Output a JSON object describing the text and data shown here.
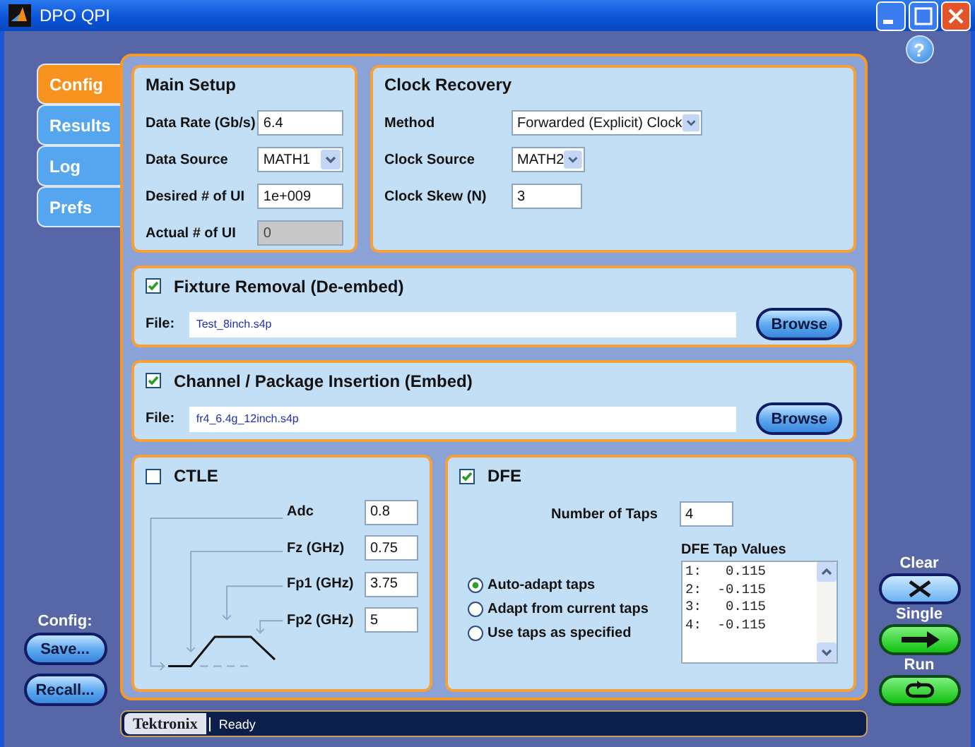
{
  "window": {
    "title": "DPO QPI"
  },
  "tabs": [
    {
      "label": "Config",
      "selected": true
    },
    {
      "label": "Results",
      "selected": false
    },
    {
      "label": "Log",
      "selected": false
    },
    {
      "label": "Prefs",
      "selected": false
    }
  ],
  "help": "?",
  "main_setup": {
    "title": "Main Setup",
    "fields": [
      {
        "label": "Data Rate (Gb/s)",
        "value": "6.4",
        "kind": "text"
      },
      {
        "label": "Data Source",
        "value": "MATH1",
        "kind": "dropdown"
      },
      {
        "label": "Desired # of UI",
        "value": "1e+009",
        "kind": "text"
      },
      {
        "label": "Actual # of UI",
        "value": "0",
        "kind": "readonly"
      }
    ]
  },
  "clock_recovery": {
    "title": "Clock Recovery",
    "fields": [
      {
        "label": "Method",
        "value": "Forwarded (Explicit) Clock",
        "kind": "dropdown"
      },
      {
        "label": "Clock Source",
        "value": "MATH2",
        "kind": "dropdown"
      },
      {
        "label": "Clock Skew (N)",
        "value": "3",
        "kind": "text"
      }
    ]
  },
  "embeds": [
    {
      "title": "Fixture Removal (De-embed)",
      "checked": true,
      "file_label": "File:",
      "file": "Test_8inch.s4p",
      "button": "Browse"
    },
    {
      "title": "Channel / Package Insertion (Embed)",
      "checked": true,
      "file_label": "File:",
      "file": "fr4_6.4g_12inch.s4p",
      "button": "Browse"
    }
  ],
  "ctle": {
    "title": "CTLE",
    "checked": false,
    "fields": [
      {
        "label": "Adc",
        "value": "0.8"
      },
      {
        "label": "Fz (GHz)",
        "value": "0.75"
      },
      {
        "label": "Fp1 (GHz)",
        "value": "3.75"
      },
      {
        "label": "Fp2 (GHz)",
        "value": "5"
      }
    ]
  },
  "dfe": {
    "title": "DFE",
    "checked": true,
    "taps_label": "Number of Taps",
    "taps_value": "4",
    "modes": [
      {
        "label": "Auto-adapt taps",
        "selected": true
      },
      {
        "label": "Adapt from current taps",
        "selected": false
      },
      {
        "label": "Use taps as specified",
        "selected": false
      }
    ],
    "tap_values_title": "DFE Tap Values",
    "tap_values": [
      "1:   0.115",
      "2:  -0.115",
      "3:   0.115",
      "4:  -0.115"
    ]
  },
  "config": {
    "label": "Config:",
    "buttons": [
      "Save...",
      "Recall..."
    ]
  },
  "actions": [
    {
      "label": "Clear",
      "kind": "clear"
    },
    {
      "label": "Single",
      "kind": "single"
    },
    {
      "label": "Run",
      "kind": "run"
    }
  ],
  "status_bar": {
    "brand": "Tektronix",
    "text": "Ready"
  }
}
